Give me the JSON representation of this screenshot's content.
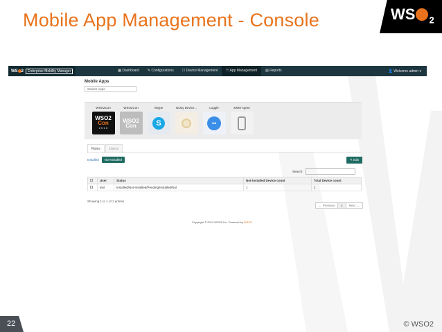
{
  "slide": {
    "title": "Mobile App Management - Console",
    "logo_text": "WS",
    "logo_suffix": "2",
    "slide_number": "22",
    "copyright": "© WSO2"
  },
  "console": {
    "brand_logo": "WS",
    "brand_logo_suffix": "2",
    "brand_text": "Enterprise Mobility Manager",
    "nav": {
      "items": [
        "Dashboard",
        "Configurations",
        "Device Management",
        "App Management",
        "Reports"
      ],
      "active_index": 3,
      "user": "Welcome admin"
    },
    "page_title": "Mobile Apps",
    "search_apps_placeholder": "Search Apps",
    "apps": [
      {
        "name": "WSO2Con",
        "icon": "wso2con-icon",
        "line1": "WSO2",
        "line2": "Con",
        "line3": "2 0 1 3"
      },
      {
        "name": "WSO2Con",
        "icon": "wso2con-grey-icon",
        "line1": "WSO2",
        "line2": "Con"
      },
      {
        "name": "Skype",
        "icon": "skype-icon",
        "glyph": "S"
      },
      {
        "name": "Gusty Device...",
        "icon": "flower-icon"
      },
      {
        "name": "Loggle",
        "icon": "loggle-icon",
        "glyph": "••"
      },
      {
        "name": "EMM Agent",
        "icon": "phone-icon"
      }
    ],
    "tabs": [
      "Roles",
      "Users"
    ],
    "filters": {
      "installed": "Installed",
      "not_installed": "Not-Installed"
    },
    "edit_button": "Edit",
    "search_label": "Search:",
    "table": {
      "headers": [
        "",
        "User",
        "Status",
        "Not-Installed Device count",
        "Total Device count"
      ],
      "rows": [
        {
          "user": "test",
          "status": "Installed/Not-Installed/Pending/Installed/Not",
          "not_installed": "1",
          "total": "1"
        }
      ]
    },
    "showing": "Showing 1 to 1 of 1 entries",
    "pager": [
      "← Previous",
      "1",
      "Next →"
    ],
    "footer": "Copyright © 2013 WSO2 Inc. Powered by",
    "footer_brand": "WSO2"
  }
}
